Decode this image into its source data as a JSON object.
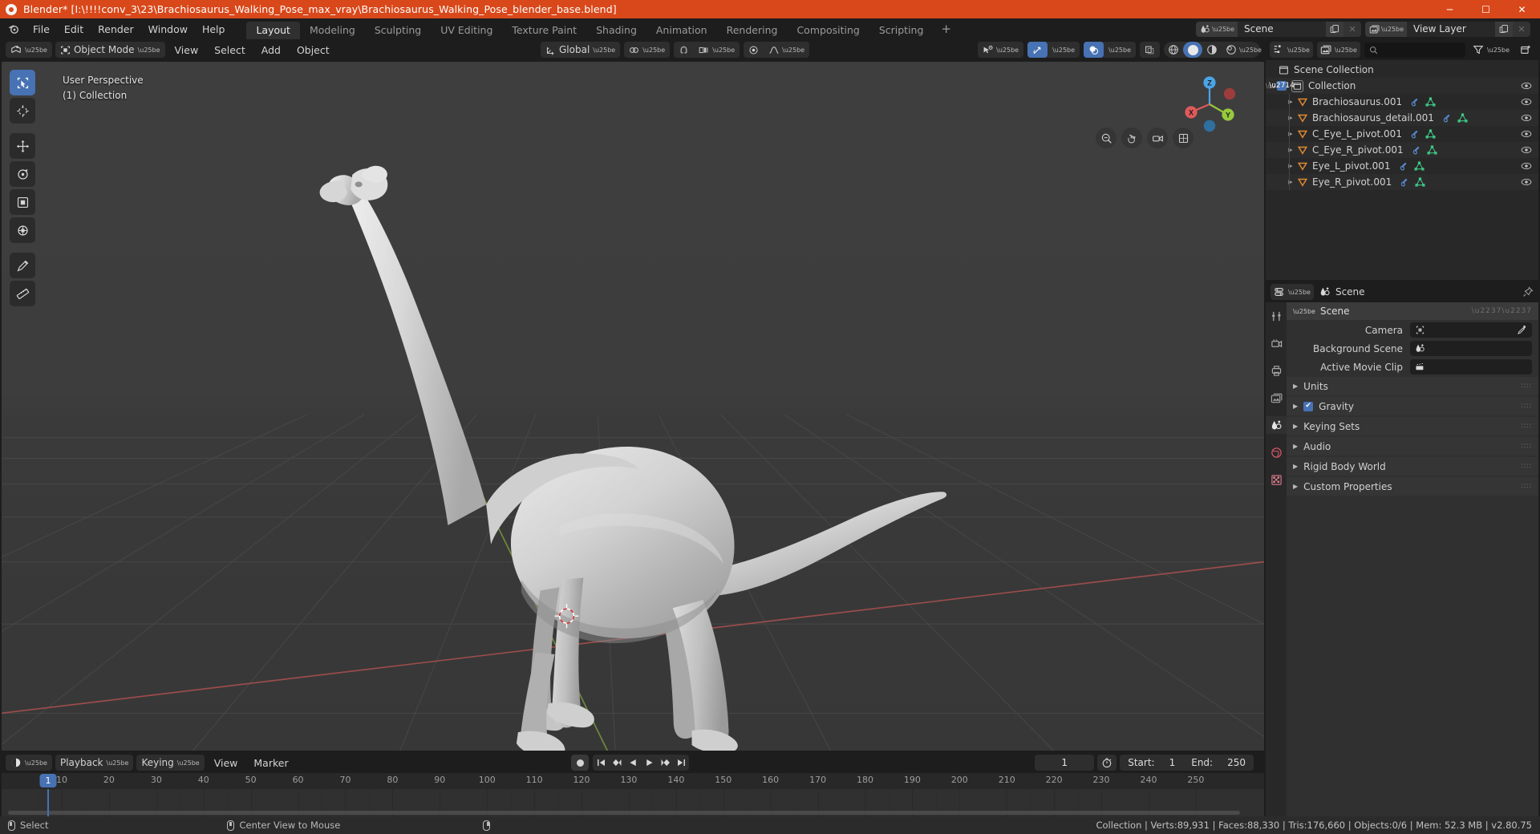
{
  "window": {
    "title": "Blender* [I:\\!!!!conv_3\\23\\Brachiosaurus_Walking_Pose_max_vray\\Brachiosaurus_Walking_Pose_blender_base.blend]",
    "minimize": "─",
    "maximize": "☐",
    "close": "✕"
  },
  "topbar": {
    "menus": [
      "File",
      "Edit",
      "Render",
      "Window",
      "Help"
    ],
    "workspaces": [
      {
        "label": "Layout",
        "active": true
      },
      {
        "label": "Modeling",
        "active": false
      },
      {
        "label": "Sculpting",
        "active": false
      },
      {
        "label": "UV Editing",
        "active": false
      },
      {
        "label": "Texture Paint",
        "active": false
      },
      {
        "label": "Shading",
        "active": false
      },
      {
        "label": "Animation",
        "active": false
      },
      {
        "label": "Rendering",
        "active": false
      },
      {
        "label": "Compositing",
        "active": false
      },
      {
        "label": "Scripting",
        "active": false
      }
    ],
    "add_workspace": "+",
    "scene": {
      "label": "Scene",
      "icon": "scene-icon",
      "new_label": "",
      "x_label": "✕"
    },
    "view_layer": {
      "label": "View Layer",
      "icon": "view-layer-icon",
      "x_label": "✕"
    }
  },
  "viewport_header": {
    "editor_type_icon": "editor-type-3dview-icon",
    "mode": "Object Mode",
    "menus": [
      "View",
      "Select",
      "Add",
      "Object"
    ],
    "transform_orientation": "Global",
    "snap_icon": "magnet-icon",
    "proportional_icon": "proportional-edit-icon",
    "pivot_icon": "pivot-point-icon",
    "falloff_icon": "falloff-curve-icon",
    "visibility_icon": "visibility-icon",
    "gizmo_icon": "gizmo-icon",
    "overlay_icon": "overlays-icon",
    "xray_icon": "xray-toggle-icon",
    "shading_modes": [
      {
        "name": "wireframe",
        "active": false
      },
      {
        "name": "solid",
        "active": true
      },
      {
        "name": "material-preview",
        "active": false
      },
      {
        "name": "rendered",
        "active": false
      }
    ]
  },
  "viewport": {
    "perspective_label": "User Perspective",
    "collection_label": "(1) Collection",
    "gizmo_axes": [
      {
        "label": "X",
        "color": "#e05a5a"
      },
      {
        "label": "Y",
        "color": "#97c93c"
      },
      {
        "label": "Z",
        "color": "#4aa5e8"
      }
    ],
    "nav_buttons": [
      "zoom-icon",
      "move-view-icon",
      "camera-view-icon",
      "toggle-ortho-icon"
    ],
    "background_color": "#3c3c3c",
    "grid_color": "#505050",
    "x_axis_color": "#9b4b4b",
    "y_axis_color": "#6b8f3a",
    "model_color": "#c9c9c9",
    "tools": [
      {
        "name": "select-box-tool",
        "active": true
      },
      {
        "name": "cursor-tool",
        "active": false
      },
      {
        "name": "move-tool",
        "active": false
      },
      {
        "name": "rotate-tool",
        "active": false
      },
      {
        "name": "scale-tool",
        "active": false
      },
      {
        "name": "transform-tool",
        "active": false
      },
      {
        "name": "annotate-tool",
        "active": false
      },
      {
        "name": "measure-tool",
        "active": false
      }
    ]
  },
  "timeline": {
    "editor_icon": "timeline-editor-icon",
    "menus": [
      "Playback",
      "Keying",
      "View",
      "Marker"
    ],
    "transport": [
      "record-icon",
      "jump-to-start-icon",
      "previous-keyframe-icon",
      "play-reverse-icon",
      "play-icon",
      "next-keyframe-icon",
      "jump-to-end-icon"
    ],
    "current_frame": "1",
    "auto_key_icon": "auto-keying-icon",
    "start_label": "Start:",
    "start_value": "1",
    "end_label": "End:",
    "end_value": "250",
    "ticks": [
      {
        "label": "10",
        "frame": 10
      },
      {
        "label": "20",
        "frame": 20
      },
      {
        "label": "30",
        "frame": 30
      },
      {
        "label": "40",
        "frame": 40
      },
      {
        "label": "50",
        "frame": 50
      },
      {
        "label": "60",
        "frame": 60
      },
      {
        "label": "70",
        "frame": 70
      },
      {
        "label": "80",
        "frame": 80
      },
      {
        "label": "90",
        "frame": 90
      },
      {
        "label": "100",
        "frame": 100
      },
      {
        "label": "110",
        "frame": 110
      },
      {
        "label": "120",
        "frame": 120
      },
      {
        "label": "130",
        "frame": 130
      },
      {
        "label": "140",
        "frame": 140
      },
      {
        "label": "150",
        "frame": 150
      },
      {
        "label": "160",
        "frame": 160
      },
      {
        "label": "170",
        "frame": 170
      },
      {
        "label": "180",
        "frame": 180
      },
      {
        "label": "190",
        "frame": 190
      },
      {
        "label": "200",
        "frame": 200
      },
      {
        "label": "210",
        "frame": 210
      },
      {
        "label": "220",
        "frame": 220
      },
      {
        "label": "230",
        "frame": 230
      },
      {
        "label": "240",
        "frame": 240
      },
      {
        "label": "250",
        "frame": 250
      }
    ],
    "playhead_label": "1",
    "playhead_color": "#4772b3"
  },
  "outliner": {
    "display_mode_icon": "outliner-display-mode-icon",
    "filter_id_icon": "filter-id-icon",
    "search_placeholder": "",
    "search_icon": "search-icon",
    "filter_icon": "filter-icon",
    "new_collection_icon": "new-collection-icon",
    "scene_collection": "Scene Collection",
    "collection": {
      "label": "Collection",
      "checked": true
    },
    "objects": [
      {
        "label": "Brachiosaurus.001",
        "icons": [
          "modifier-icon",
          "mesh-data-icon"
        ],
        "visible": true
      },
      {
        "label": "Brachiosaurus_detail.001",
        "icons": [
          "modifier-icon",
          "mesh-data-icon"
        ],
        "visible": true
      },
      {
        "label": "C_Eye_L_pivot.001",
        "icons": [
          "modifier-icon",
          "mesh-data-icon"
        ],
        "visible": true
      },
      {
        "label": "C_Eye_R_pivot.001",
        "icons": [
          "modifier-icon",
          "mesh-data-icon"
        ],
        "visible": true
      },
      {
        "label": "Eye_L_pivot.001",
        "icons": [
          "modifier-icon",
          "mesh-data-icon"
        ],
        "visible": true
      },
      {
        "label": "Eye_R_pivot.001",
        "icons": [
          "modifier-icon",
          "mesh-data-icon"
        ],
        "visible": true
      }
    ]
  },
  "properties": {
    "editor_icon": "properties-editor-icon",
    "breadcrumb_icon": "scene-icon",
    "breadcrumb": "Scene",
    "pin_icon": "pin-icon",
    "tabs": [
      {
        "name": "tool-tab",
        "active": false
      },
      {
        "name": "render-tab",
        "active": false
      },
      {
        "name": "output-tab",
        "active": false
      },
      {
        "name": "view-layer-tab",
        "active": false
      },
      {
        "name": "scene-tab",
        "active": true
      },
      {
        "name": "world-tab",
        "active": false
      },
      {
        "name": "texture-tab",
        "active": false
      }
    ],
    "panel_title": "Scene",
    "fields": [
      {
        "label": "Camera",
        "value": "",
        "icon": "camera-icon",
        "eyedropper": true
      },
      {
        "label": "Background Scene",
        "value": "",
        "icon": "scene-icon",
        "eyedropper": false
      },
      {
        "label": "Active Movie Clip",
        "value": "",
        "icon": "movie-clip-icon",
        "eyedropper": false
      }
    ],
    "sections": [
      {
        "label": "Units",
        "checkbox": null
      },
      {
        "label": "Gravity",
        "checkbox": true
      },
      {
        "label": "Keying Sets",
        "checkbox": null
      },
      {
        "label": "Audio",
        "checkbox": null
      },
      {
        "label": "Rigid Body World",
        "checkbox": null
      },
      {
        "label": "Custom Properties",
        "checkbox": null
      }
    ]
  },
  "statusbar": {
    "left_items": [
      {
        "icon": "mouse-left-icon",
        "label": "Select"
      },
      {
        "icon": "mouse-middle-icon",
        "label": "Center View to Mouse"
      },
      {
        "icon": "mouse-right-icon",
        "label": ""
      }
    ],
    "stats": "Collection | Verts:89,931 | Faces:88,330 | Tris:176,660 | Objects:0/6 | Mem: 52.3 MB | v2.80.75"
  }
}
